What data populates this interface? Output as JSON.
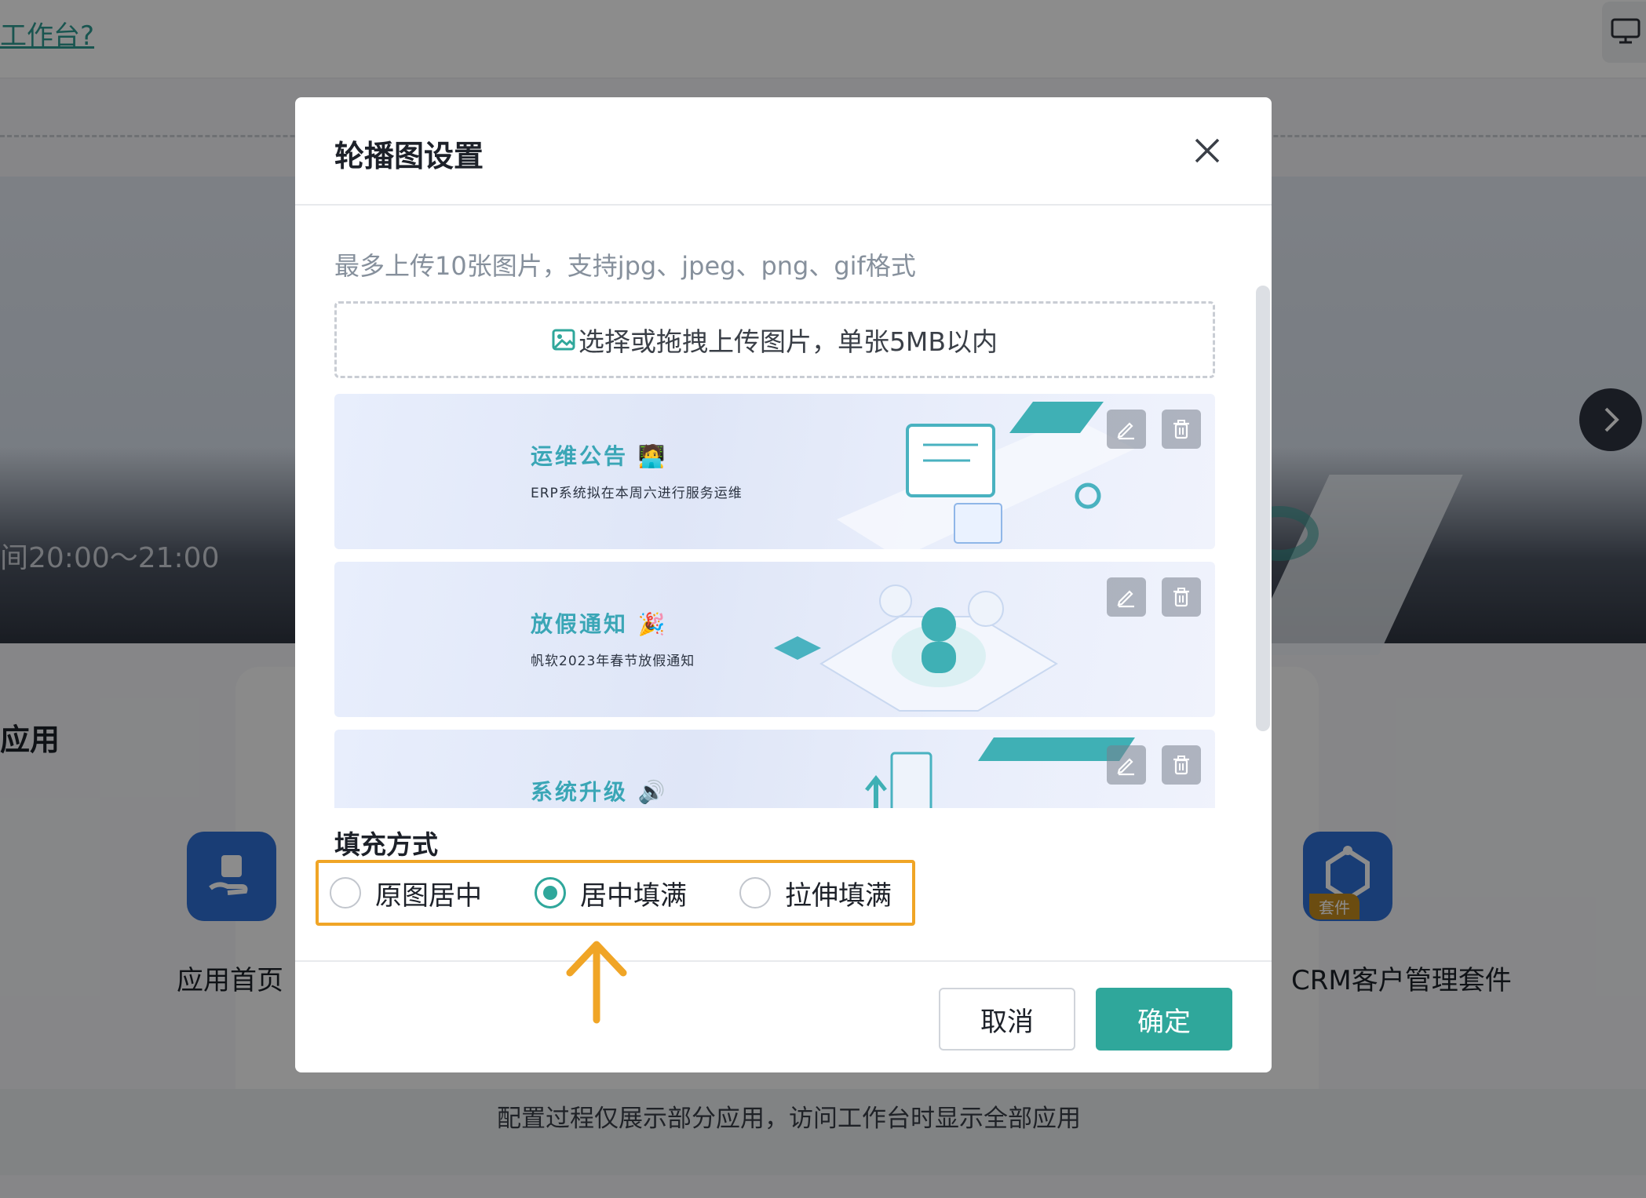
{
  "background": {
    "top_link": "工作台?",
    "banner_time_text": "间20:00～21:00",
    "section_title": "应用",
    "apps": [
      {
        "label": "应用首页"
      },
      {
        "label": "CRM客户管理套件",
        "tag": "套件"
      }
    ],
    "footer_text": "配置过程仅展示部分应用，访问工作台时显示全部应用"
  },
  "modal": {
    "title": "轮播图设置",
    "hint": "最多上传10张图片，支持jpg、jpeg、png、gif格式",
    "upload_label": "选择或拖拽上传图片，单张5MB以内",
    "images": [
      {
        "title": "运维公告 🧑‍💻",
        "subtitle": "ERP系统拟在本周六进行服务运维"
      },
      {
        "title": "放假通知 🎉",
        "subtitle": "帆软2023年春节放假通知"
      },
      {
        "title": "系统升级 🔊",
        "subtitle": ""
      }
    ],
    "fill_mode_label": "填充方式",
    "fill_options": [
      {
        "label": "原图居中",
        "selected": false
      },
      {
        "label": "居中填满",
        "selected": true
      },
      {
        "label": "拉伸填满",
        "selected": false
      }
    ],
    "cancel_label": "取消",
    "ok_label": "确定"
  },
  "colors": {
    "accent": "#2fa79b",
    "highlight": "#f0a526",
    "overlay": "rgba(0,0,0,0.45)"
  },
  "icons": [
    "close-icon",
    "image-icon",
    "edit-icon",
    "trash-icon",
    "chevron-right-icon",
    "monitor-icon",
    "arrow-up-icon"
  ]
}
